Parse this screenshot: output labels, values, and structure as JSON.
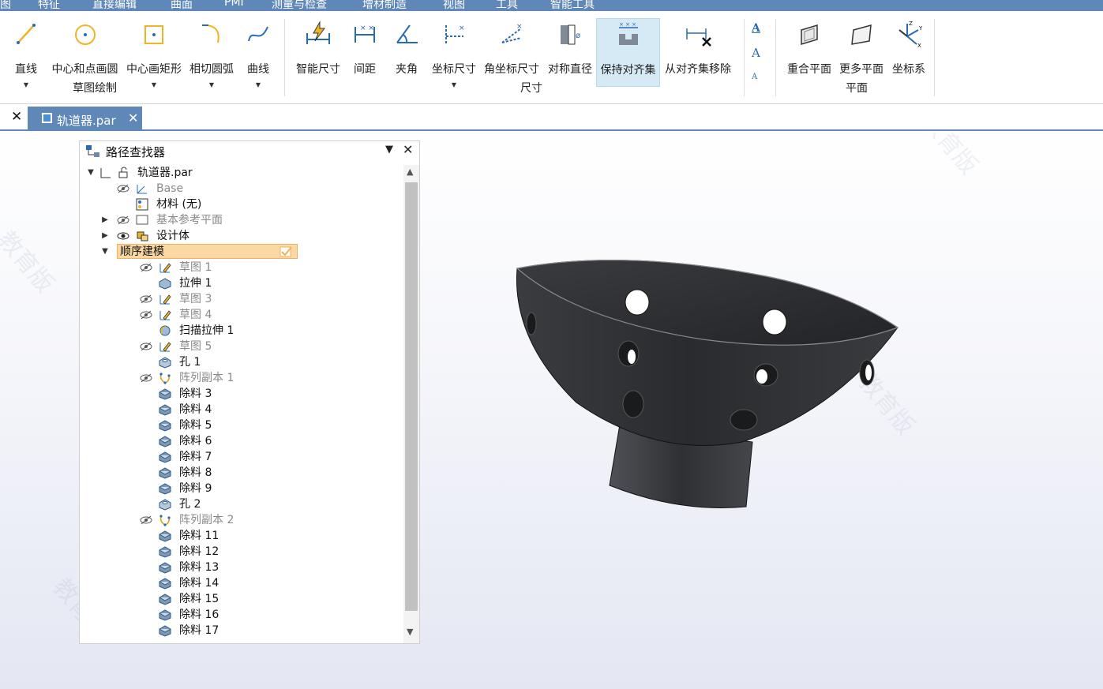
{
  "menu": {
    "tabs": [
      "图",
      "特征",
      "直接编辑",
      "曲面",
      "PMI",
      "测量与检查",
      "增材制造",
      "视图",
      "工具",
      "智能工具"
    ]
  },
  "ribbon": {
    "line": "直线",
    "circle": "中心和点画圆",
    "rect": "中心画矩形",
    "arc": "相切圆弧",
    "curve": "曲线",
    "group_sketch": "草图绘制",
    "smart_dim": "智能尺寸",
    "distance": "间距",
    "angle": "夹角",
    "coord_dim": "坐标尺寸",
    "angular_coord_dim": "角坐标尺寸",
    "symmetric_dia": "对称直径",
    "keep_align": "保持对齐集",
    "remove_align": "从对齐集移除",
    "group_dim": "尺寸",
    "coincident_plane": "重合平面",
    "more_planes": "更多平面",
    "coordinate_system": "坐标系",
    "group_plane": "平面"
  },
  "document": {
    "tab_name": "轨道器.par"
  },
  "pathfinder": {
    "title": "路径查找器",
    "items": [
      {
        "label": "轨道器.par"
      },
      {
        "label": "Base"
      },
      {
        "label": "材料 (无)"
      },
      {
        "label": "基本参考平面"
      },
      {
        "label": "设计体"
      },
      {
        "label": "顺序建模"
      },
      {
        "label": "草图 1"
      },
      {
        "label": "拉伸 1"
      },
      {
        "label": "草图 3"
      },
      {
        "label": "草图 4"
      },
      {
        "label": "扫描拉伸 1"
      },
      {
        "label": "草图 5"
      },
      {
        "label": "孔 1"
      },
      {
        "label": "阵列副本 1"
      },
      {
        "label": "除料 3"
      },
      {
        "label": "除料 4"
      },
      {
        "label": "除料 5"
      },
      {
        "label": "除料 6"
      },
      {
        "label": "除料 7"
      },
      {
        "label": "除料 8"
      },
      {
        "label": "除料 9"
      },
      {
        "label": "孔 2"
      },
      {
        "label": "阵列副本 2"
      },
      {
        "label": "除料 11"
      },
      {
        "label": "除料 12"
      },
      {
        "label": "除料 13"
      },
      {
        "label": "除料 14"
      },
      {
        "label": "除料 15"
      },
      {
        "label": "除料 16"
      },
      {
        "label": "除料 17"
      }
    ]
  },
  "watermark": "教育版",
  "colors": {
    "accent": "#5f88b8",
    "highlight": "#fcd9a4",
    "model": "#2f3033",
    "icon": "#2a6ab0"
  }
}
